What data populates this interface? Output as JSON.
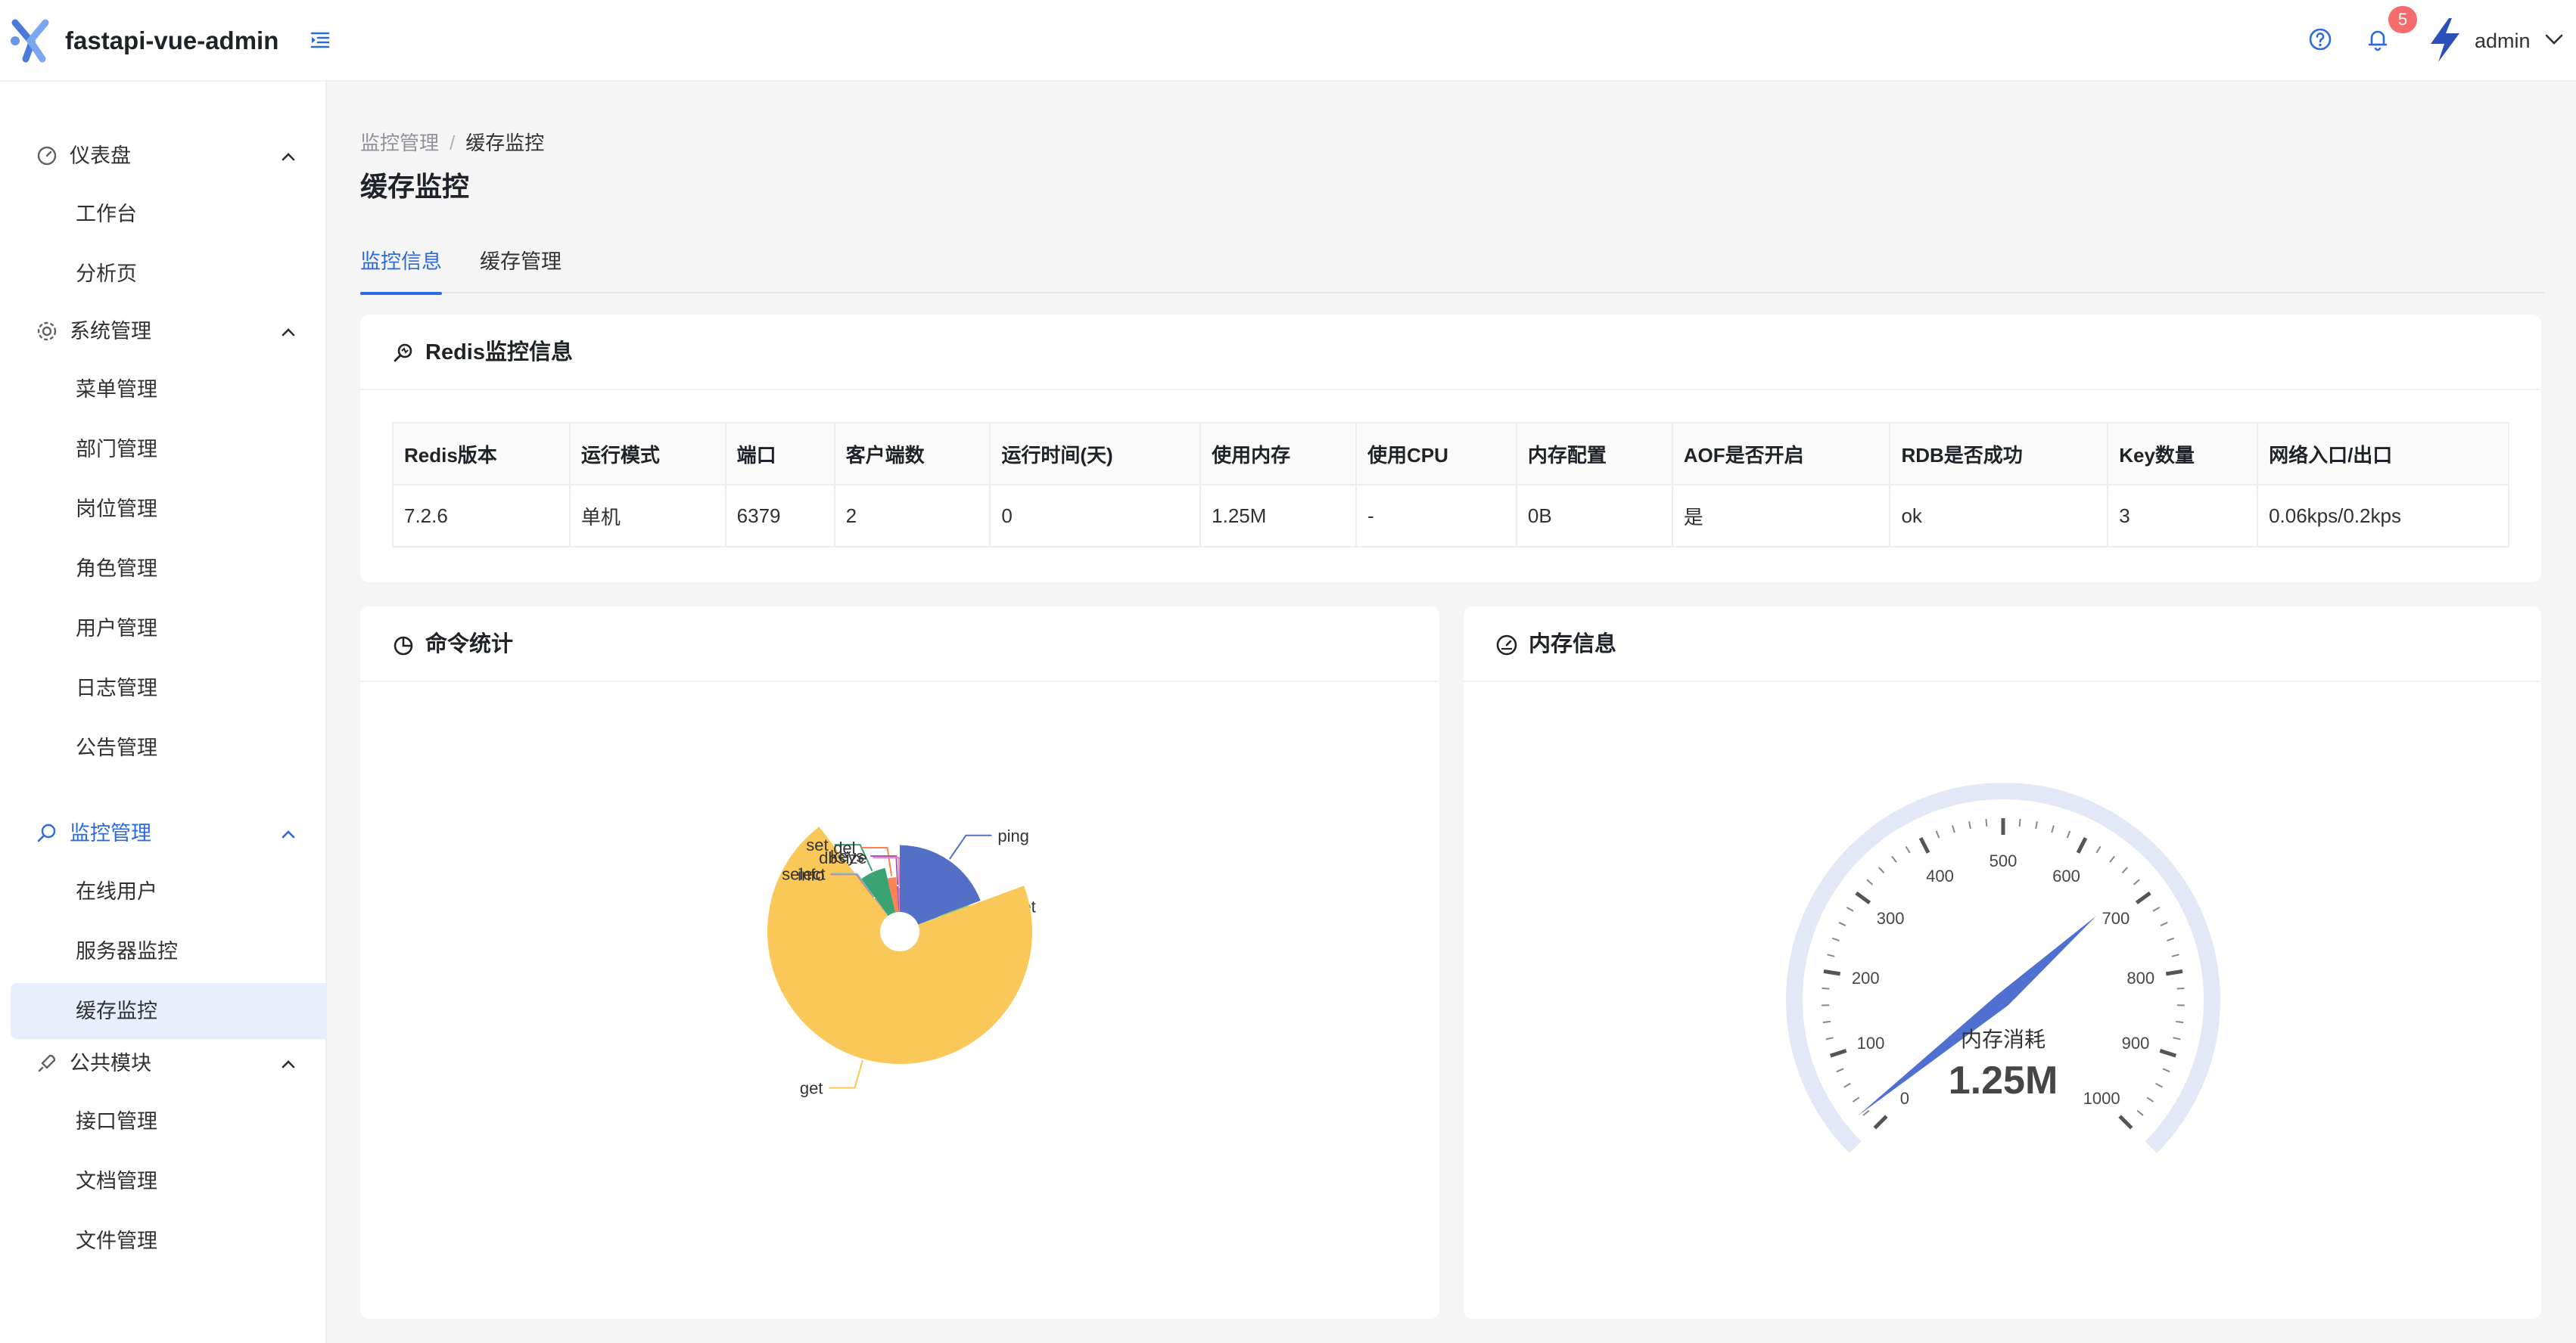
{
  "app": {
    "title": "fastapi-vue-admin",
    "brand_color": "#2d6ae0"
  },
  "header": {
    "notification_count": "5",
    "username": "admin"
  },
  "sidebar": {
    "groups": [
      {
        "label": "仪表盘",
        "icon": "dashboard-icon",
        "items": [
          "工作台",
          "分析页"
        ]
      },
      {
        "label": "系统管理",
        "icon": "gear-icon",
        "items": [
          "菜单管理",
          "部门管理",
          "岗位管理",
          "角色管理",
          "用户管理",
          "日志管理",
          "公告管理"
        ]
      },
      {
        "label": "监控管理",
        "icon": "monitor-search-icon",
        "items": [
          "在线用户",
          "服务器监控",
          "缓存监控"
        ],
        "active": true,
        "selected_item": "缓存监控"
      },
      {
        "label": "公共模块",
        "icon": "rocket-icon",
        "items": [
          "接口管理",
          "文档管理",
          "文件管理"
        ]
      }
    ]
  },
  "breadcrumb": {
    "parent": "监控管理",
    "separator": "/",
    "current": "缓存监控"
  },
  "page": {
    "title": "缓存监控"
  },
  "tabs": [
    {
      "label": "监控信息",
      "active": true
    },
    {
      "label": "缓存管理",
      "active": false
    }
  ],
  "redis_card": {
    "title": "Redis监控信息",
    "columns": [
      "Redis版本",
      "运行模式",
      "端口",
      "客户端数",
      "运行时间(天)",
      "使用内存",
      "使用CPU",
      "内存配置",
      "AOF是否开启",
      "RDB是否成功",
      "Key数量",
      "网络入口/出口"
    ],
    "row": [
      "7.2.6",
      "单机",
      "6379",
      "2",
      "0",
      "1.25M",
      "-",
      "0B",
      "是",
      "ok",
      "3",
      "0.06kps/0.2kps"
    ]
  },
  "command_card": {
    "title": "命令统计"
  },
  "memory_card": {
    "title": "内存信息"
  },
  "chart_data": [
    {
      "type": "pie",
      "variant": "rose",
      "labels": [
        "ping",
        "mget",
        "get",
        "info",
        "select",
        "set",
        "del",
        "keys",
        "dbsize"
      ],
      "values": [
        90,
        1,
        330,
        1,
        1,
        30,
        12,
        3,
        2
      ],
      "colors": [
        "#5470c6",
        "#91cc75",
        "#fac858",
        "#ee6666",
        "#73c0de",
        "#3ba272",
        "#fc8452",
        "#9a60b4",
        "#ea7ccc"
      ]
    },
    {
      "type": "gauge",
      "name": "内存消耗",
      "value": 1.25,
      "display": "1.25M",
      "min": 0,
      "max": 1000,
      "ticks": [
        "0",
        "100",
        "200",
        "300",
        "400",
        "500",
        "600",
        "700",
        "800",
        "900",
        "1000"
      ]
    }
  ]
}
